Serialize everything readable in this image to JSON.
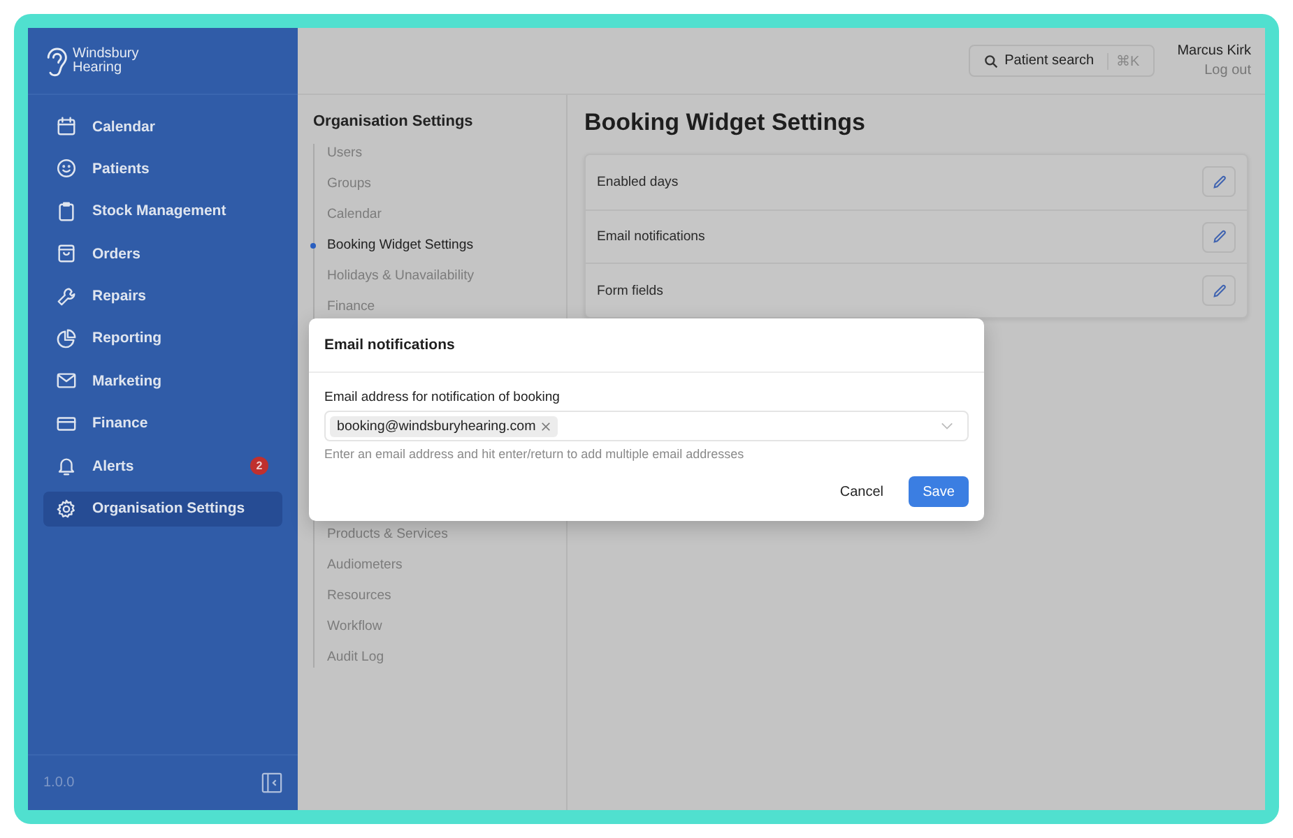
{
  "brand": {
    "name": "Windsbury Hearing"
  },
  "sidebar": {
    "items": [
      {
        "label": "Calendar",
        "selected": false
      },
      {
        "label": "Patients",
        "selected": false
      },
      {
        "label": "Stock Management",
        "selected": false
      },
      {
        "label": "Orders",
        "selected": false
      },
      {
        "label": "Repairs",
        "selected": false
      },
      {
        "label": "Reporting",
        "selected": false
      },
      {
        "label": "Marketing",
        "selected": false
      },
      {
        "label": "Finance",
        "selected": false
      },
      {
        "label": "Alerts",
        "selected": false,
        "badge": "2"
      },
      {
        "label": "Organisation Settings",
        "selected": true
      }
    ],
    "version": "1.0.0"
  },
  "header": {
    "search": {
      "label": "Patient search",
      "shortcut": "⌘K"
    },
    "user": {
      "name": "Marcus Kirk",
      "logout": "Log out"
    }
  },
  "settings_nav": {
    "title": "Organisation Settings",
    "items_top": [
      {
        "label": "Users",
        "selected": false
      },
      {
        "label": "Groups",
        "selected": false
      },
      {
        "label": "Calendar",
        "selected": false
      },
      {
        "label": "Booking Widget Settings",
        "selected": true
      },
      {
        "label": "Holidays & Unavailability",
        "selected": false
      },
      {
        "label": "Finance",
        "selected": false
      }
    ],
    "items_bottom": [
      {
        "label": "Products & Services",
        "selected": false
      },
      {
        "label": "Audiometers",
        "selected": false
      },
      {
        "label": "Resources",
        "selected": false
      },
      {
        "label": "Workflow",
        "selected": false
      },
      {
        "label": "Audit Log",
        "selected": false
      }
    ]
  },
  "page": {
    "title": "Booking Widget Settings",
    "rows": [
      "Enabled days",
      "Email notifications",
      "Form fields"
    ]
  },
  "modal": {
    "title": "Email notifications",
    "field_label": "Email address for notification of booking",
    "tags": [
      "booking@windsburyhearing.com"
    ],
    "help": "Enter an email address and hit enter/return to add multiple email addresses",
    "buttons": {
      "cancel": "Cancel",
      "save": "Save"
    }
  }
}
